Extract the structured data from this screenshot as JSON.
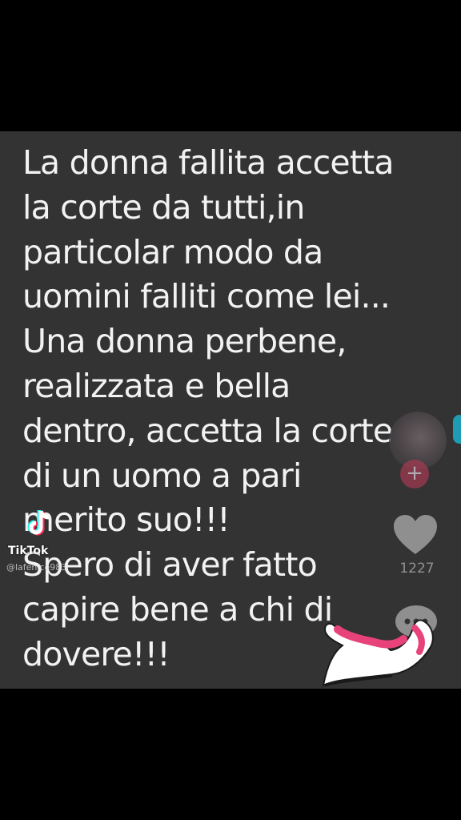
{
  "post": {
    "text": "La donna fallita accetta\nla corte da tutti,in\nparticolar modo da\nuomini falliti come lei...\nUna donna perbene,\nrealizzata e bella\ndentro, accetta la corte\ndi un uomo a pari\nmerito suo!!!\nSpero di aver fatto\ncapire bene a chi di\ndovere!!!"
  },
  "watermark": {
    "brand": "TikTok",
    "handle": "@lafenice983"
  },
  "actions": {
    "follow_label": "+",
    "like_count": "1227"
  },
  "colors": {
    "background": "#000000",
    "frame": "#333333",
    "text": "#f2f2f2",
    "follow": "#b83a56",
    "sticker": "#e8427a"
  },
  "icons": [
    "tiktok-logo-icon",
    "plus-icon",
    "heart-icon",
    "comment-icon",
    "flexed-arm-sticker-icon"
  ]
}
